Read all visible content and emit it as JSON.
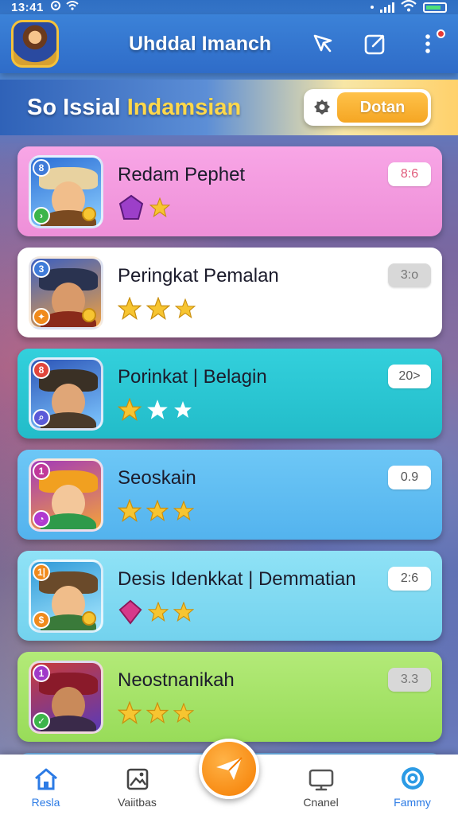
{
  "status_bar": {
    "time": "13:41"
  },
  "header": {
    "title": "Uhddal Imanch"
  },
  "banner": {
    "title_part1": "So Issial",
    "title_part2": "Indamsian",
    "button_label": "Dotan"
  },
  "cards": [
    {
      "title": "Redam Pephet",
      "score": "8:6",
      "rank_top": "8",
      "theme": "pink"
    },
    {
      "title": "Peringkat Pemalan",
      "score": "3:o",
      "rank_top": "3",
      "theme": "white"
    },
    {
      "title": "Porinkat | Belagin",
      "score": "20>",
      "rank_top": "8",
      "theme": "teal"
    },
    {
      "title": "Seoskain",
      "score": "0.9",
      "rank_top": "1",
      "theme": "sky"
    },
    {
      "title": "Desis Idenkkat | Demmatian",
      "score": "2:6",
      "rank_top": "1|",
      "theme": "aqua"
    },
    {
      "title": "Neostnanikah",
      "score": "3.3",
      "rank_top": "1",
      "theme": "lime"
    }
  ],
  "nav": [
    {
      "label": "Resla",
      "icon": "home-icon",
      "active": true
    },
    {
      "label": "Vaiitbas",
      "icon": "gallery-icon",
      "active": false
    },
    {
      "label": "Cnanel",
      "icon": "tv-icon",
      "active": false
    },
    {
      "label": "Fammy",
      "icon": "settings-icon",
      "active": true
    }
  ],
  "colors": {
    "primary": "#2f6cc8",
    "accent": "#f5a623",
    "active_nav": "#2c7be5",
    "star": "#f7c531"
  }
}
